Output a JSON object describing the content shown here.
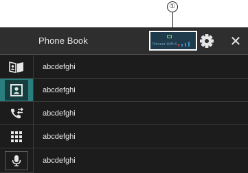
{
  "callout": {
    "number": "①"
  },
  "header": {
    "title": "Phone Book",
    "close_glyph": "✕",
    "status_tiny_text": "Pioneer AVH-X..."
  },
  "sidebar": {
    "items": [
      {
        "name": "contacts-book-icon",
        "active": false
      },
      {
        "name": "phone-book-icon",
        "active": true
      },
      {
        "name": "call-history-icon",
        "active": false
      },
      {
        "name": "dial-pad-icon",
        "active": false
      },
      {
        "name": "voice-recognition-icon",
        "active": false
      }
    ]
  },
  "list": {
    "rows": [
      {
        "label": "abcdefghi"
      },
      {
        "label": "abcdefghi"
      },
      {
        "label": "abcdefghi"
      },
      {
        "label": "abcdefghi"
      },
      {
        "label": "abcdefghi"
      }
    ]
  },
  "colors": {
    "background": "#1c1c1c",
    "header": "#2e2e2e",
    "accent": "#2b7e7e",
    "text": "#e6e6e6"
  }
}
